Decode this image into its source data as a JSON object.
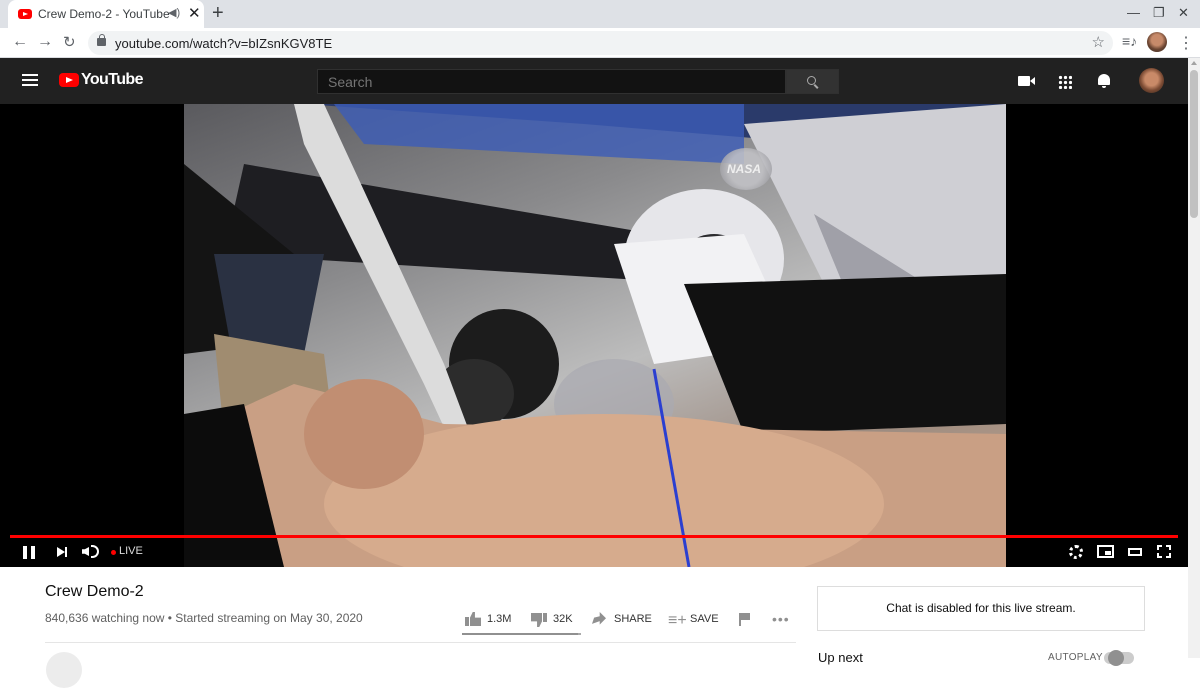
{
  "browser": {
    "tab_title": "Crew Demo-2 - YouTube",
    "url": "youtube.com/watch?v=bIZsnKGV8TE",
    "new_tab_label": "+",
    "tab_close": "✕"
  },
  "youtube": {
    "logo_text": "YouTube",
    "search_placeholder": "Search"
  },
  "player": {
    "status": "LIVE",
    "progress_fraction": 1.0,
    "watermark": "NASA"
  },
  "video": {
    "title": "Crew Demo-2",
    "meta": "840,636 watching now • Started streaming on May 30, 2020",
    "likes": "1.3M",
    "dislikes": "32K",
    "share_label": "SHARE",
    "save_label": "SAVE",
    "like_ratio": 0.976
  },
  "sidebar": {
    "chat_notice": "Chat is disabled for this live stream.",
    "up_next": "Up next",
    "autoplay": "AUTOPLAY",
    "autoplay_on": false
  },
  "icons": [
    "youtube-favicon",
    "audio-icon",
    "close-icon",
    "back-icon",
    "forward-icon",
    "reload-icon",
    "lock-icon",
    "star-icon",
    "media-icon",
    "menu-icon",
    "hamburger-icon",
    "search-icon",
    "create-video-icon",
    "apps-icon",
    "bell-icon",
    "pause-icon",
    "next-icon",
    "volume-icon",
    "settings-icon",
    "miniplayer-icon",
    "theater-icon",
    "fullscreen-icon",
    "like-icon",
    "dislike-icon",
    "share-icon",
    "save-icon",
    "flag-icon",
    "more-icon"
  ],
  "colors": {
    "brand": "#ff0000",
    "header_bg": "#212121",
    "progress": "#ff0000"
  }
}
